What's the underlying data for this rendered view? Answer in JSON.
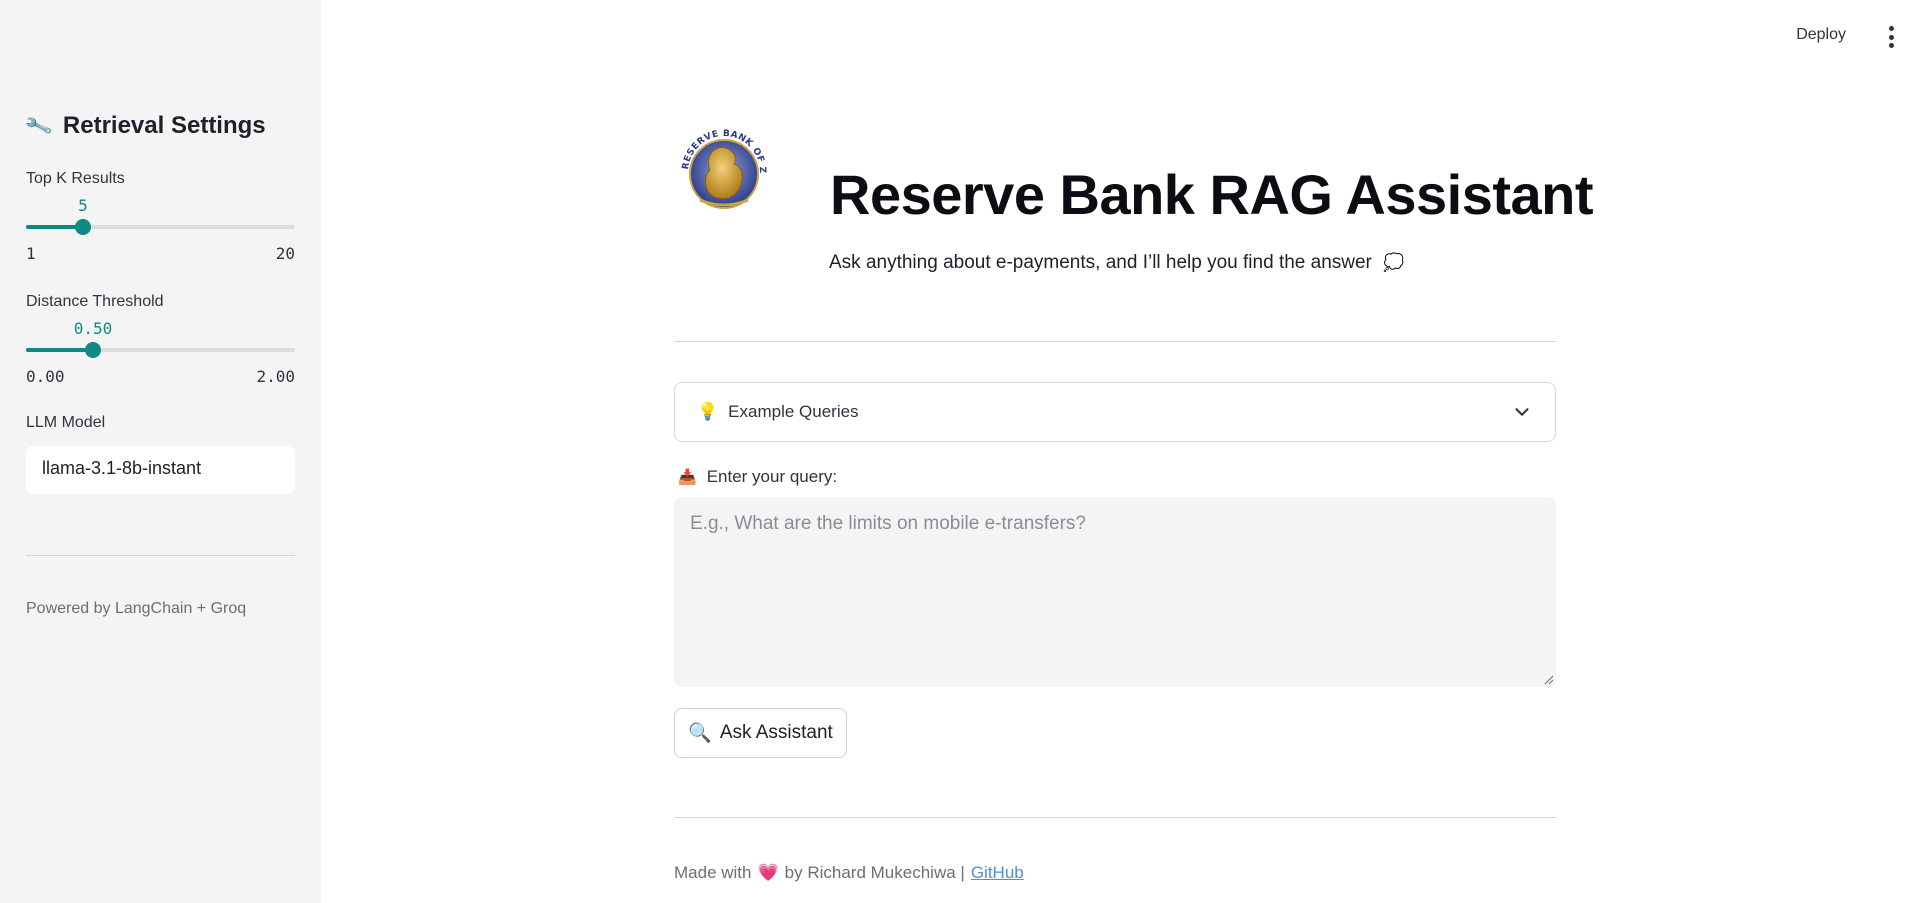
{
  "sidebar": {
    "title": "Retrieval Settings",
    "wrench_icon": "🔧",
    "top_k": {
      "label": "Top K Results",
      "value": "5",
      "min": "1",
      "max": "20",
      "fraction": 0.2105
    },
    "distance": {
      "label": "Distance Threshold",
      "value": "0.50",
      "min": "0.00",
      "max": "2.00",
      "fraction": 0.25
    },
    "llm": {
      "label": "LLM Model",
      "value": "llama-3.1-8b-instant"
    },
    "footer": "Powered by LangChain + Groq"
  },
  "header": {
    "deploy_label": "Deploy",
    "menu_icon": "kebab-menu-icon"
  },
  "main": {
    "title": "Reserve Bank RAG Assistant",
    "subtitle": "Ask anything about e-payments, and I’ll help you find the answer",
    "subtitle_icon": "💭",
    "logo_text": "RESERVE BANK OF ZIMBABWE",
    "examples": {
      "icon": "💡",
      "label": "Example Queries"
    },
    "query": {
      "icon": "📥",
      "label": "Enter your query:",
      "placeholder": "E.g., What are the limits on mobile e-transfers?",
      "value": ""
    },
    "ask_button": {
      "icon": "🔍",
      "label": "Ask Assistant"
    },
    "footer": {
      "prefix": "Made with",
      "heart": "💗",
      "by": "by Richard Mukechiwa |",
      "link": "GitHub"
    }
  },
  "colors": {
    "accent": "#0e8a85",
    "sidebar_bg": "#f4f4f4",
    "link": "#4a90e2"
  }
}
